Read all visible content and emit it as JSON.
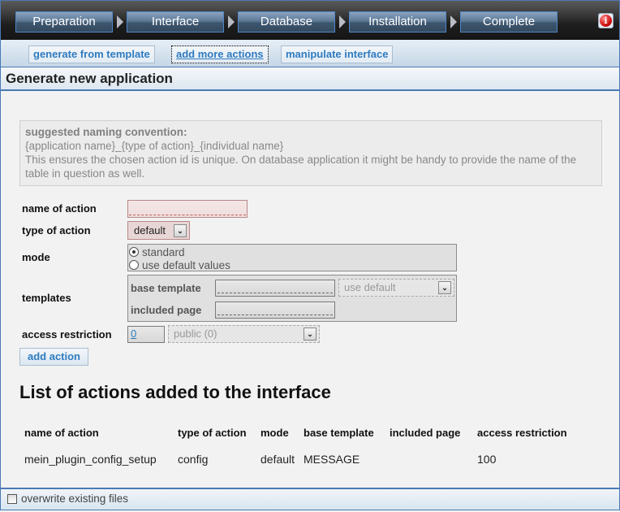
{
  "steps": [
    {
      "label": "Preparation"
    },
    {
      "label": "Interface"
    },
    {
      "label": "Database"
    },
    {
      "label": "Installation"
    },
    {
      "label": "Complete"
    }
  ],
  "info_icon": {
    "glyph": "i"
  },
  "subtabs": [
    {
      "label": "generate from template",
      "active": false
    },
    {
      "label": "add more actions",
      "active": true
    },
    {
      "label": "manipulate interface",
      "active": false
    }
  ],
  "panel": {
    "title": "Generate new application",
    "hint": {
      "title": "suggested naming convention:",
      "line1": "{application name}_{type of action}_{individual name}",
      "line2": "This ensures the chosen action id is unique. On database application it might be handy to provide the name of the table in question as well."
    },
    "form": {
      "name_label": "name of action",
      "name_value": "",
      "type_label": "type of action",
      "type_value": "default",
      "mode_label": "mode",
      "mode_options": [
        {
          "label": "standard",
          "checked": true
        },
        {
          "label": "use default values",
          "checked": false
        }
      ],
      "templates_label": "templates",
      "base_template_label": "base template",
      "base_template_value": "",
      "base_template_select": "use default",
      "included_page_label": "included page",
      "included_page_value": "",
      "access_label": "access restriction",
      "access_value": "0",
      "access_select": "public (0)",
      "add_button": "add action"
    },
    "list": {
      "title": "List of actions added to the interface",
      "columns": [
        "name of action",
        "type of action",
        "mode",
        "base template",
        "included page",
        "access restriction"
      ],
      "rows": [
        [
          "mein_plugin_config_setup",
          "config",
          "default",
          "MESSAGE",
          "",
          "100"
        ]
      ]
    }
  },
  "footer": {
    "overwrite_label": "overwrite existing files",
    "overwrite_checked": false
  },
  "colors": {
    "accent_blue": "#2f7bbf",
    "border_blue": "#4a7ab5",
    "required_field": "#efdede"
  }
}
